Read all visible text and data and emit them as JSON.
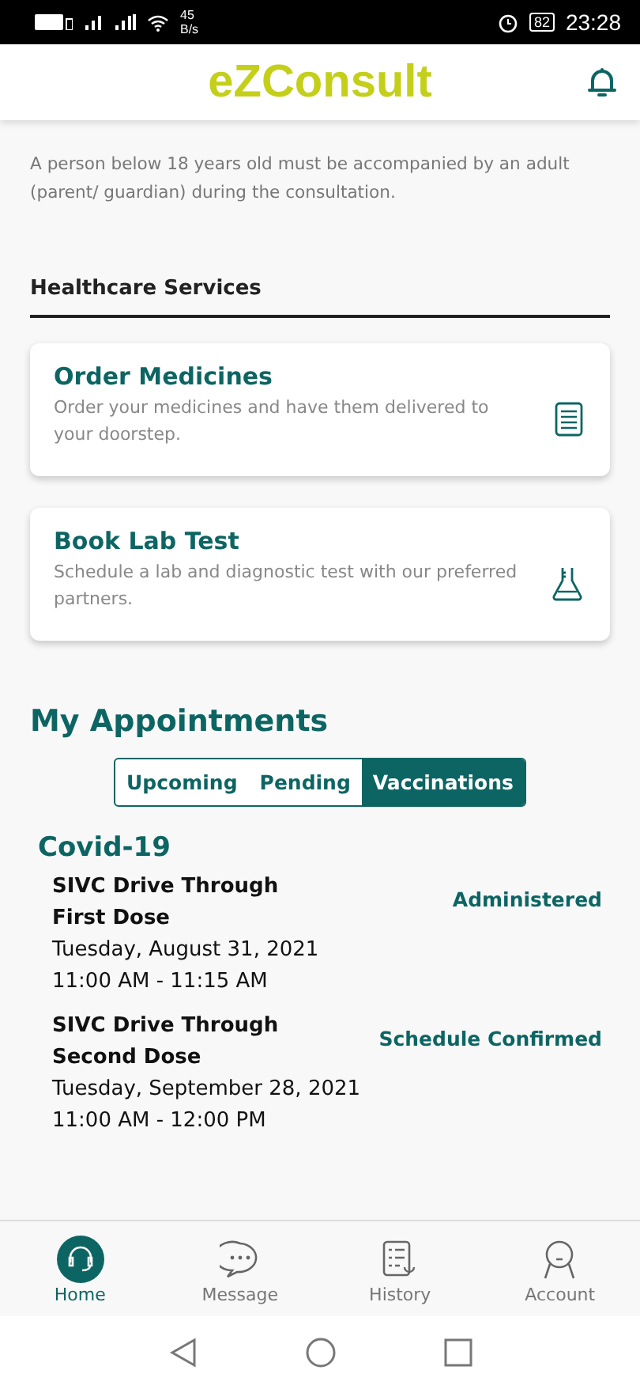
{
  "status_bar": {
    "speed": "45",
    "speed_unit": "B/s",
    "battery": "82",
    "time": "23:28"
  },
  "header": {
    "title": "eZConsult"
  },
  "notice": "A person below 18 years old must be accompanied by an adult (parent/ guardian) during the consultation.",
  "services": {
    "heading": "Healthcare Services",
    "cards": [
      {
        "kind": "document",
        "title": "Order Medicines",
        "description": "Order your medicines and have them delivered to your doorstep."
      },
      {
        "kind": "flask",
        "title": "Book Lab Test",
        "description": "Schedule a lab and diagnostic test with our preferred partners."
      }
    ]
  },
  "appointments": {
    "heading": "My Appointments",
    "tabs": [
      {
        "label": "Upcoming",
        "selected": false
      },
      {
        "label": "Pending",
        "selected": false
      },
      {
        "label": "Vaccinations",
        "selected": true
      }
    ],
    "group": "Covid-19",
    "items": [
      {
        "place": "SIVC Drive Through",
        "dose": "First Dose",
        "date": "Tuesday, August 31, 2021",
        "time": "11:00 AM - 11:15 AM",
        "status": "Administered"
      },
      {
        "place": "SIVC Drive Through",
        "dose": "Second Dose",
        "date": "Tuesday, September 28, 2021",
        "time": "11:00 AM - 12:00 PM",
        "status": "Schedule Confirmed"
      }
    ]
  },
  "bottom_nav": [
    {
      "kind": "home",
      "label": "Home",
      "selected": true
    },
    {
      "kind": "message",
      "label": "Message",
      "selected": false
    },
    {
      "kind": "history",
      "label": "History",
      "selected": false
    },
    {
      "kind": "account",
      "label": "Account",
      "selected": false
    }
  ]
}
